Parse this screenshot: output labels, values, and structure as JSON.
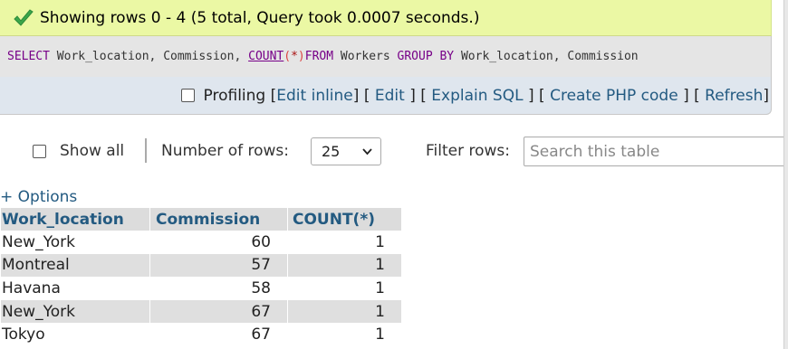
{
  "message": {
    "text": "Showing rows 0 - 4 (5 total, Query took 0.0007 seconds.)",
    "icon": "check-icon"
  },
  "sql": {
    "select": "SELECT",
    "cols": " Work_location, Commission, ",
    "count": "COUNT",
    "open": "(",
    "star": "*",
    "close": ")",
    "from": "FROM",
    "table": " Workers ",
    "groupby": "GROUP BY",
    "groupcols": " Work_location, Commission"
  },
  "actions": {
    "profiling": "Profiling",
    "lb": "[",
    "rb": "]",
    "edit_inline": "Edit inline",
    "edit": "Edit",
    "explain": "Explain SQL",
    "php": "Create PHP code",
    "refresh": "Refresh"
  },
  "controls": {
    "show_all": "Show all",
    "num_rows_label": "Number of rows:",
    "num_rows_value": "25",
    "filter_label": "Filter rows:",
    "search_placeholder": "Search this table"
  },
  "options_label": "+ Options",
  "table": {
    "headers": [
      "Work_location",
      "Commission",
      "COUNT(*)"
    ],
    "rows": [
      [
        "New_York",
        "60",
        "1"
      ],
      [
        "Montreal",
        "57",
        "1"
      ],
      [
        "Havana",
        "58",
        "1"
      ],
      [
        "New_York",
        "67",
        "1"
      ],
      [
        "Tokyo",
        "67",
        "1"
      ]
    ]
  },
  "colors": {
    "success_bg": "#ebf8a4",
    "link": "#235a81",
    "sql_keyword": "#770088"
  }
}
